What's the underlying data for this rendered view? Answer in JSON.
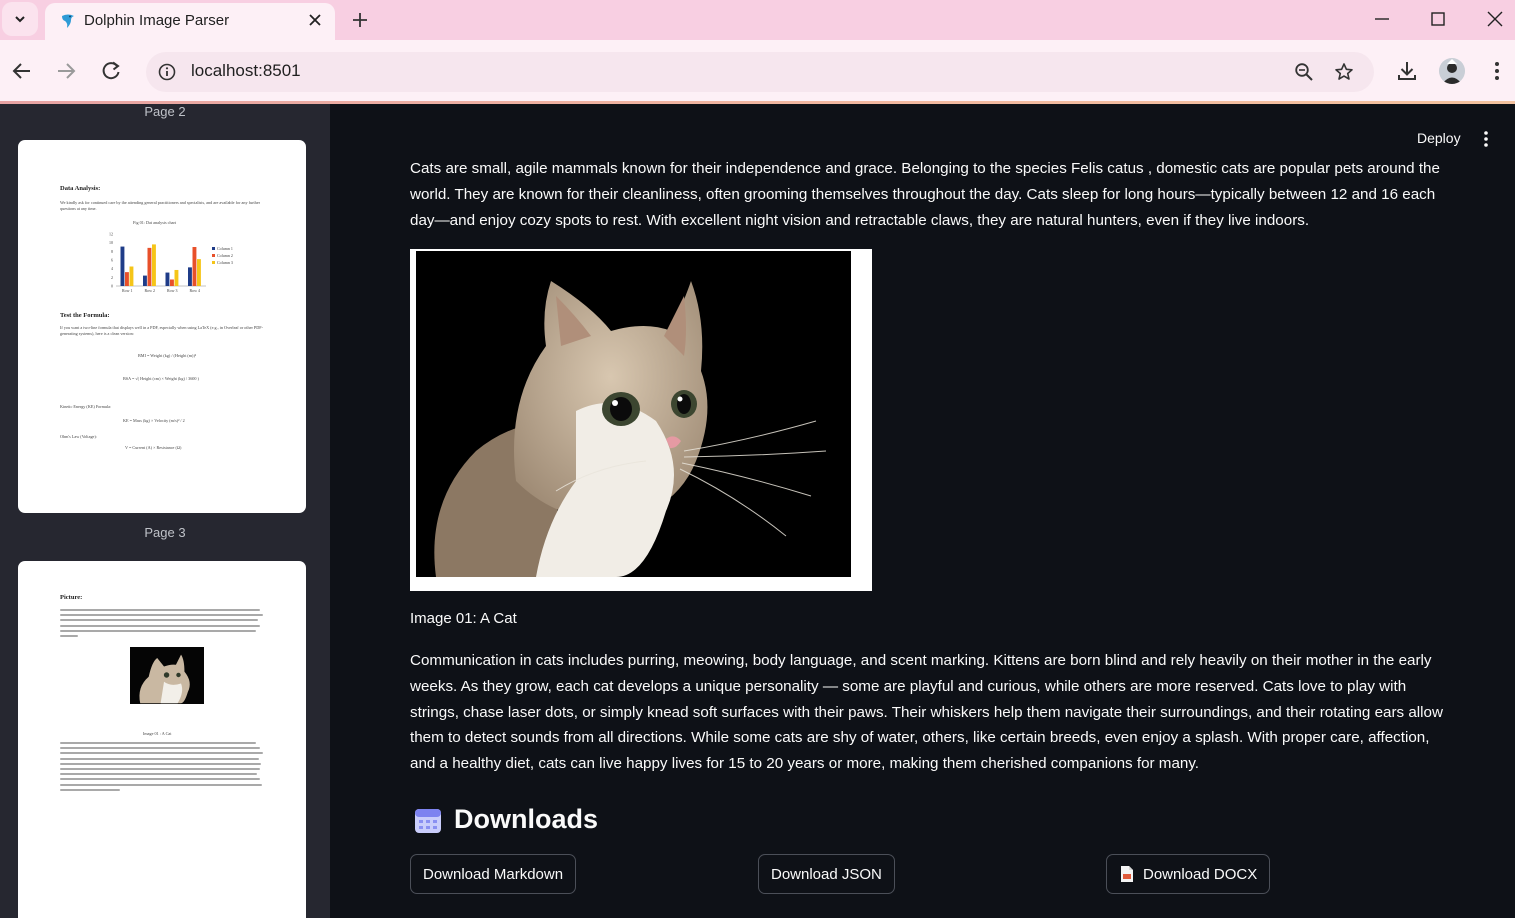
{
  "browser": {
    "tab_title": "Dolphin Image Parser",
    "url": "localhost:8501"
  },
  "header": {
    "deploy_label": "Deploy"
  },
  "sidebar": {
    "page2_label": "Page 2",
    "page3_label": "Page 3",
    "page2": {
      "section_heading": "Data Analysis:",
      "intro": "We kindly ask for continued care by the attending general practitioners and specialists, and are available for any further questions at any time.",
      "figure_title": "Fig 01: Dat analysis chart",
      "chart_data": {
        "type": "bar",
        "categories": [
          "Row 1",
          "Row 2",
          "Row 3",
          "Row 4"
        ],
        "series": [
          {
            "name": "Column 1",
            "values": [
              9.1,
              2.4,
              3.1,
              4.3
            ]
          },
          {
            "name": "Column 2",
            "values": [
              3.2,
              8.8,
              1.5,
              9.0
            ]
          },
          {
            "name": "Column 3",
            "values": [
              4.5,
              9.6,
              3.7,
              6.2
            ]
          }
        ],
        "ylim": [
          0,
          12
        ],
        "yticks": [
          "0",
          "2",
          "4",
          "6",
          "8",
          "10",
          "12"
        ],
        "colors": [
          "#1f3c88",
          "#e8502a",
          "#f5c518"
        ],
        "legend": "right"
      },
      "formula_heading": "Test the Formula:",
      "formula_intro": "If you want a two-line formula that displays well in a PDF, especially when using LaTeX (e.g., in Overleaf or other PDF-generating systems), here is a clean version:",
      "bmi_formula": "BMI = Weight (kg) / (Height (m))²",
      "bsa_formula": "BSA = √( Height (cm) × Weight (kg) / 3600 )",
      "ke_label": "Kinetic Energy (KE) Formula:",
      "ke_formula": "KE = Mass (kg) × Velocity (m/s)² / 2",
      "ohm_label": "Ohm's Law (Voltage):",
      "ohm_formula": "V = Current (A) × Resistance (Ω)"
    },
    "page3": {
      "section_heading": "Picture:",
      "caption": "Image 01 : A Cat"
    }
  },
  "main": {
    "paragraph1": "Cats are small, agile mammals known for their independence and grace. Belonging to the species Felis catus , domestic cats are popular pets around the world. They are known for their cleanliness, often grooming themselves throughout the day. Cats sleep for long hours—typically between 12 and 16 each day—and enjoy cozy spots to rest. With excellent night vision and retractable claws, they are natural hunters, even if they live indoors.",
    "image_caption": "Image 01: A Cat",
    "paragraph2": "Communication in cats includes purring, meowing, body language, and scent marking. Kittens are born blind and rely heavily on their mother in the early weeks. As they grow, each cat develops a unique personality — some are playful and curious, while others are more reserved. Cats love to play with strings, chase laser dots, or simply knead soft surfaces with their paws. Their whiskers help them navigate their surroundings, and their rotating ears allow them to detect sounds from all directions. While some cats are shy of water, others, like certain breeds, even enjoy a splash. With proper care, affection, and a healthy diet, cats can live happy lives for 15 to 20 years or more, making them cherished companions for many.",
    "downloads_heading": "Downloads",
    "buttons": {
      "markdown": "Download Markdown",
      "json": "Download JSON",
      "docx": "Download DOCX"
    }
  },
  "icons": {
    "downloads_heading_icon": "calendar-icon",
    "docx_button_icon": "document-icon"
  }
}
